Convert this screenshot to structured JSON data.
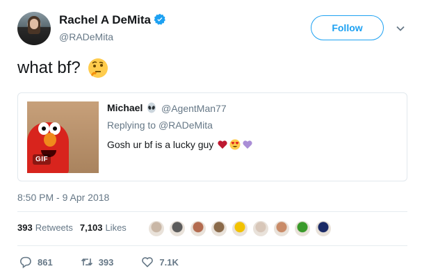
{
  "author": {
    "display_name": "Rachel A DeMita",
    "handle": "@RADeMita",
    "verified": true
  },
  "follow_label": "Follow",
  "tweet": {
    "text": "what bf?",
    "emoji_icon": "thinking-face-icon"
  },
  "quoted": {
    "display_name": "Michael",
    "name_emoji_icon": "alien-icon",
    "handle": "@AgentMan77",
    "replying_prefix": "Replying to",
    "replying_to": "@RADeMita",
    "text": "Gosh ur bf is a lucky guy",
    "emoji_icons": [
      "red-heart-icon",
      "heart-eyes-face-icon",
      "purple-heart-icon"
    ],
    "media_badge": "GIF"
  },
  "timestamp": "8:50 PM - 9 Apr 2018",
  "stats": {
    "retweets_count": "393",
    "retweets_label": "Retweets",
    "likes_count": "7,103",
    "likes_label": "Likes"
  },
  "liker_faces": [
    {
      "color": "#c9b7a6"
    },
    {
      "color": "#5c5c5c"
    },
    {
      "color": "#b36b4f"
    },
    {
      "color": "#8a6a4a"
    },
    {
      "color": "#f2c200"
    },
    {
      "color": "#d8c7b9"
    },
    {
      "color": "#c98b68"
    },
    {
      "color": "#3a9a2a"
    },
    {
      "color": "#1a2a66"
    }
  ],
  "actions": {
    "reply_count": "861",
    "retweet_count": "393",
    "like_count": "7.1K"
  },
  "colors": {
    "accent": "#1da1f2",
    "secondary_text": "#657786",
    "primary_text": "#14171a"
  }
}
